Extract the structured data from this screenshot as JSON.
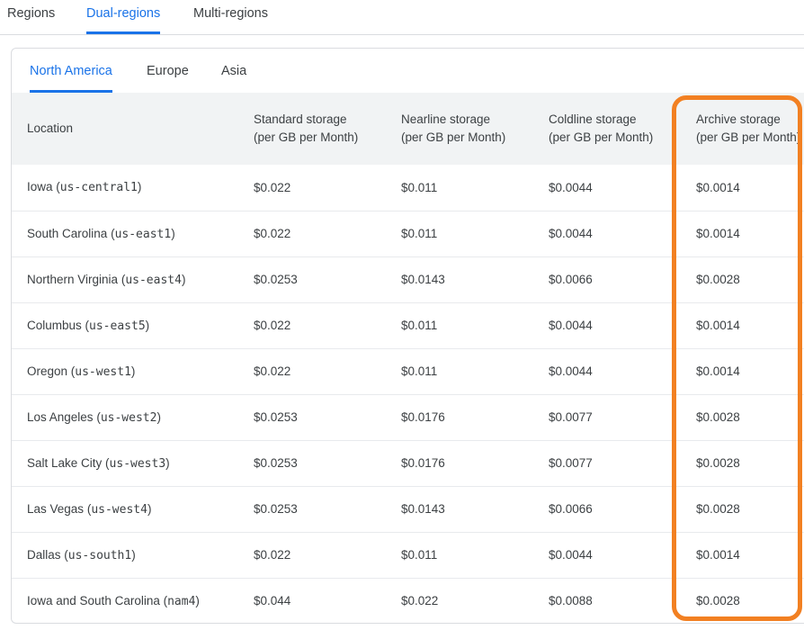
{
  "top_tabs": [
    {
      "label": "Regions",
      "active": false
    },
    {
      "label": "Dual-regions",
      "active": true
    },
    {
      "label": "Multi-regions",
      "active": false
    }
  ],
  "sub_tabs": [
    {
      "label": "North America",
      "active": true
    },
    {
      "label": "Europe",
      "active": false
    },
    {
      "label": "Asia",
      "active": false
    }
  ],
  "table": {
    "headers": [
      {
        "line1": "Location",
        "line2": ""
      },
      {
        "line1": "Standard storage",
        "line2": "(per GB per Month)"
      },
      {
        "line1": "Nearline storage",
        "line2": "(per GB per Month)"
      },
      {
        "line1": "Coldline storage",
        "line2": "(per GB per Month)"
      },
      {
        "line1": "Archive storage",
        "line2": "(per GB per Month)"
      }
    ],
    "rows": [
      {
        "location": "Iowa",
        "code": "us-central1",
        "standard": "$0.022",
        "nearline": "$0.011",
        "coldline": "$0.0044",
        "archive": "$0.0014"
      },
      {
        "location": "South Carolina",
        "code": "us-east1",
        "standard": "$0.022",
        "nearline": "$0.011",
        "coldline": "$0.0044",
        "archive": "$0.0014"
      },
      {
        "location": "Northern Virginia",
        "code": "us-east4",
        "standard": "$0.0253",
        "nearline": "$0.0143",
        "coldline": "$0.0066",
        "archive": "$0.0028"
      },
      {
        "location": "Columbus",
        "code": "us-east5",
        "standard": "$0.022",
        "nearline": "$0.011",
        "coldline": "$0.0044",
        "archive": "$0.0014"
      },
      {
        "location": "Oregon",
        "code": "us-west1",
        "standard": "$0.022",
        "nearline": "$0.011",
        "coldline": "$0.0044",
        "archive": "$0.0014"
      },
      {
        "location": "Los Angeles",
        "code": "us-west2",
        "standard": "$0.0253",
        "nearline": "$0.0176",
        "coldline": "$0.0077",
        "archive": "$0.0028"
      },
      {
        "location": "Salt Lake City",
        "code": "us-west3",
        "standard": "$0.0253",
        "nearline": "$0.0176",
        "coldline": "$0.0077",
        "archive": "$0.0028"
      },
      {
        "location": "Las Vegas",
        "code": "us-west4",
        "standard": "$0.0253",
        "nearline": "$0.0143",
        "coldline": "$0.0066",
        "archive": "$0.0028"
      },
      {
        "location": "Dallas",
        "code": "us-south1",
        "standard": "$0.022",
        "nearline": "$0.011",
        "coldline": "$0.0044",
        "archive": "$0.0014"
      },
      {
        "location": "Iowa and South Carolina",
        "code": "nam4",
        "standard": "$0.044",
        "nearline": "$0.022",
        "coldline": "$0.0088",
        "archive": "$0.0028"
      }
    ]
  },
  "colors": {
    "accent": "#1a73e8",
    "highlight": "#f28022",
    "header_bg": "#f1f3f4"
  }
}
